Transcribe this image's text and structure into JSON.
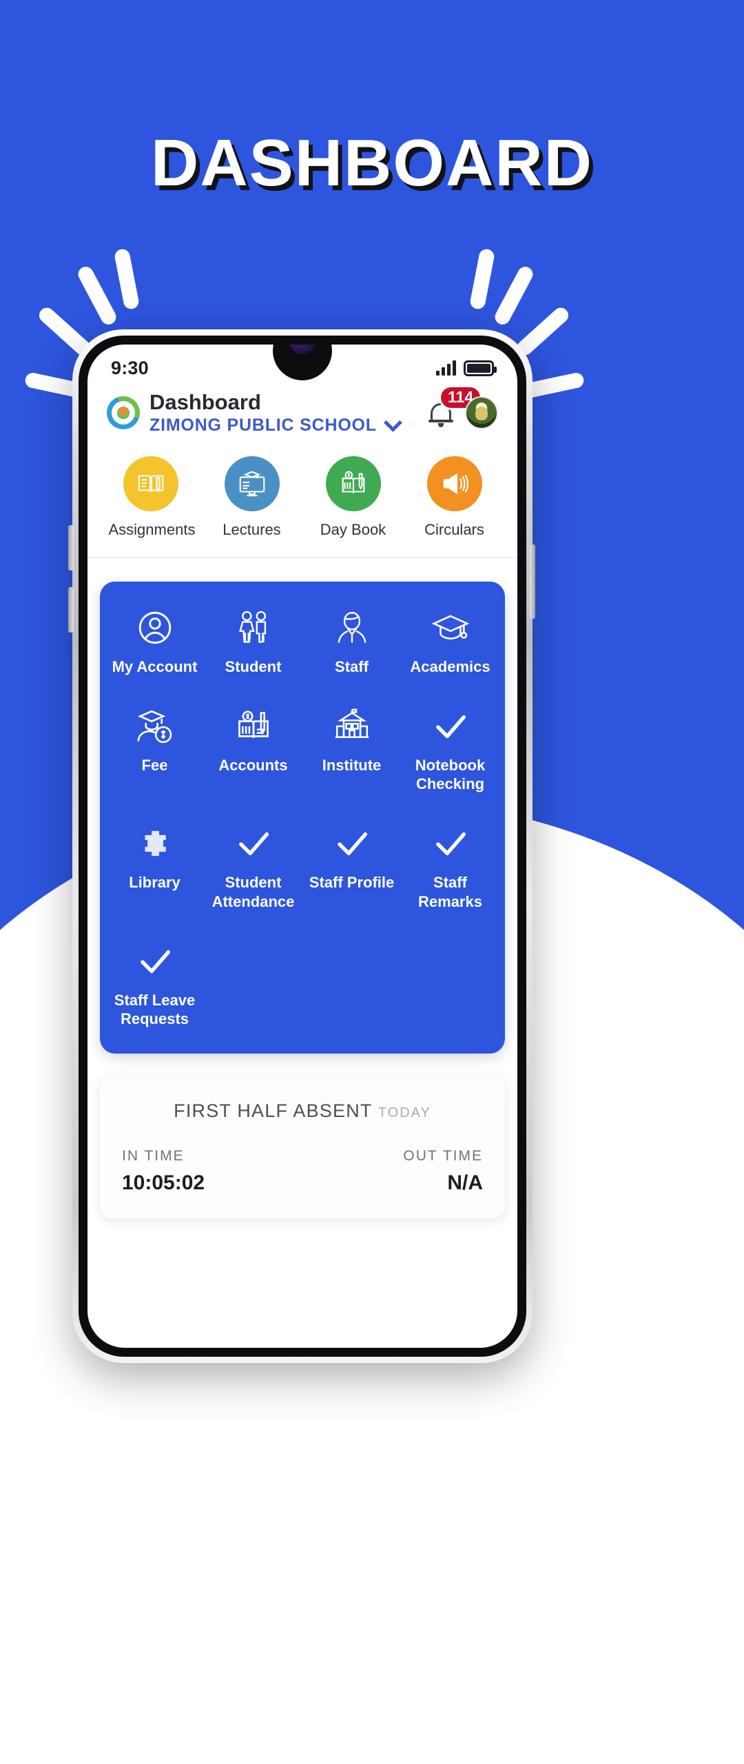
{
  "headline": "DASHBOARD",
  "status_bar": {
    "time": "9:30",
    "signal_icon": "signal-bars-icon",
    "battery_icon": "battery-icon"
  },
  "app_bar": {
    "logo_icon": "school-logo-icon",
    "title": "Dashboard",
    "school_name": "ZIMONG PUBLIC SCHOOL",
    "dropdown_icon": "chevron-down-icon",
    "bell_icon": "bell-icon",
    "notification_count": "114",
    "avatar_icon": "user-avatar"
  },
  "quick_actions": [
    {
      "label": "Assignments",
      "icon": "book-pencil-icon",
      "color": "#f5c32c"
    },
    {
      "label": "Lectures",
      "icon": "monitor-graduation-cap-icon",
      "color": "#4a90c4"
    },
    {
      "label": "Day Book",
      "icon": "ledger-money-pen-icon",
      "color": "#3faa52"
    },
    {
      "label": "Circulars",
      "icon": "megaphone-icon",
      "color": "#f29022"
    }
  ],
  "menu": {
    "background_color": "#2d55dd",
    "items": [
      {
        "label": "My Account",
        "icon": "user-circle-icon"
      },
      {
        "label": "Student",
        "icon": "two-students-icon"
      },
      {
        "label": "Staff",
        "icon": "staff-person-icon"
      },
      {
        "label": "Academics",
        "icon": "graduation-cap-icon"
      },
      {
        "label": "Fee",
        "icon": "graduate-dollar-icon"
      },
      {
        "label": "Accounts",
        "icon": "ledger-money-pen-icon"
      },
      {
        "label": "Institute",
        "icon": "school-building-icon"
      },
      {
        "label": "Notebook\nChecking",
        "icon": "check-icon"
      },
      {
        "label": "Library",
        "icon": "library-books-icon"
      },
      {
        "label": "Student\nAttendance",
        "icon": "check-icon"
      },
      {
        "label": "Staff Profile",
        "icon": "check-icon"
      },
      {
        "label": "Staff Remarks",
        "icon": "check-icon"
      },
      {
        "label": "Staff Leave\nRequests",
        "icon": "check-icon"
      }
    ]
  },
  "attendance_card": {
    "status": "FIRST HALF ABSENT",
    "period": "TODAY",
    "in_label": "IN TIME",
    "in_value": "10:05:02",
    "out_label": "OUT TIME",
    "out_value": "N/A"
  }
}
